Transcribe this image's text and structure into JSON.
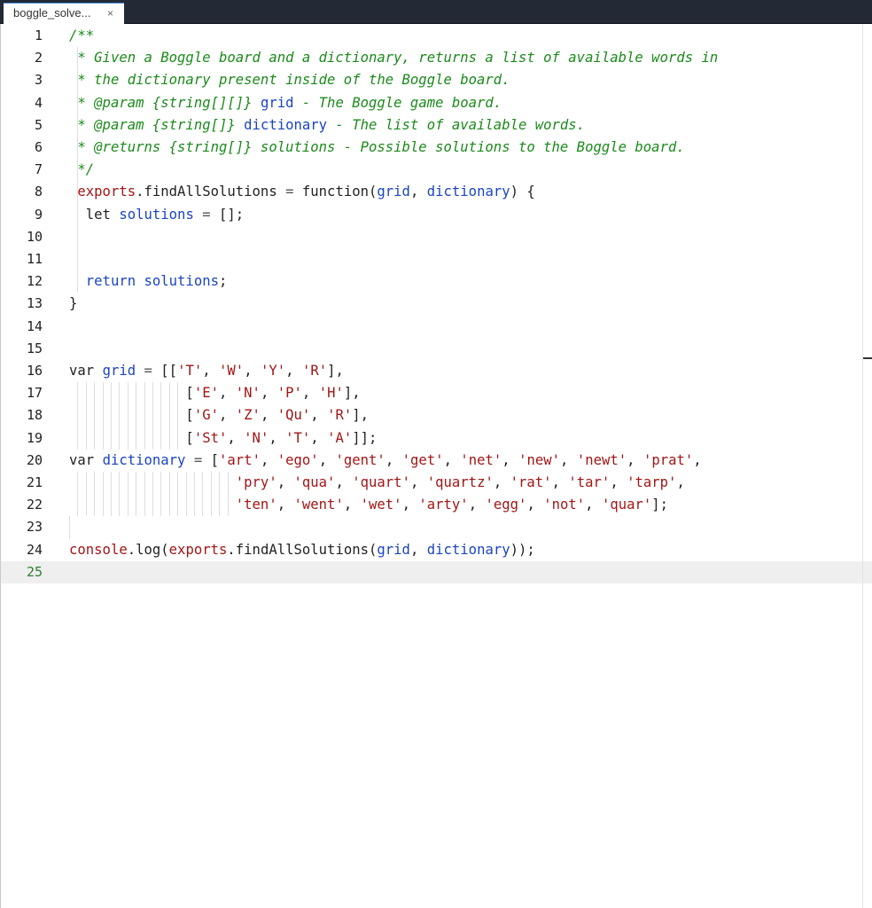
{
  "tab": {
    "title": "boggle_solve...",
    "close_glyph": "×"
  },
  "gutter": {
    "current_line": "25"
  },
  "lines": [
    {
      "n": "1",
      "tokens": [
        {
          "c": "cmt",
          "t": "/**"
        }
      ]
    },
    {
      "n": "2",
      "tokens": [
        {
          "c": "cmt",
          "t": " * Given a Boggle board and a dictionary, returns a list of available words in"
        }
      ]
    },
    {
      "n": "3",
      "tokens": [
        {
          "c": "cmt",
          "t": " * the dictionary present inside of the Boggle board."
        }
      ]
    },
    {
      "n": "4",
      "tokens": [
        {
          "c": "cmt",
          "t": " * @param {string[][]} "
        },
        {
          "c": "var",
          "t": "grid"
        },
        {
          "c": "cmt",
          "t": " - The Boggle game board."
        }
      ]
    },
    {
      "n": "5",
      "tokens": [
        {
          "c": "cmt",
          "t": " * @param {string[]} "
        },
        {
          "c": "var",
          "t": "dictionary"
        },
        {
          "c": "cmt",
          "t": " - The list of available words."
        }
      ]
    },
    {
      "n": "6",
      "tokens": [
        {
          "c": "cmt",
          "t": " * @returns {string[]} solutions - Possible solutions to the Boggle board."
        }
      ]
    },
    {
      "n": "7",
      "tokens": [
        {
          "c": "cmt",
          "t": " */"
        }
      ]
    },
    {
      "n": "8",
      "tokens": [
        {
          "c": "prop",
          "t": " exports"
        },
        {
          "c": "kw",
          "t": ".findAllSolutions "
        },
        {
          "c": "op",
          "t": "="
        },
        {
          "c": "kw",
          "t": " function("
        },
        {
          "c": "var",
          "t": "grid"
        },
        {
          "c": "kw",
          "t": ", "
        },
        {
          "c": "var",
          "t": "dictionary"
        },
        {
          "c": "kw",
          "t": ") {"
        }
      ]
    },
    {
      "n": "9",
      "tokens": [
        {
          "c": "kw",
          "t": "  let "
        },
        {
          "c": "var",
          "t": "solutions"
        },
        {
          "c": "op",
          "t": " ="
        },
        {
          "c": "kw",
          "t": " [];"
        }
      ]
    },
    {
      "n": "10",
      "tokens": []
    },
    {
      "n": "11",
      "tokens": []
    },
    {
      "n": "12",
      "tokens": [
        {
          "c": "var",
          "t": "  return solutions"
        },
        {
          "c": "kw",
          "t": ";"
        }
      ]
    },
    {
      "n": "13",
      "tokens": [
        {
          "c": "kw",
          "t": "}"
        }
      ]
    },
    {
      "n": "14",
      "tokens": []
    },
    {
      "n": "15",
      "tokens": []
    },
    {
      "n": "16",
      "tokens": [
        {
          "c": "kw",
          "t": "var "
        },
        {
          "c": "var",
          "t": "grid"
        },
        {
          "c": "op",
          "t": " ="
        },
        {
          "c": "kw",
          "t": " [["
        },
        {
          "c": "str",
          "t": "'T'"
        },
        {
          "c": "kw",
          "t": ", "
        },
        {
          "c": "str",
          "t": "'W'"
        },
        {
          "c": "kw",
          "t": ", "
        },
        {
          "c": "str",
          "t": "'Y'"
        },
        {
          "c": "kw",
          "t": ", "
        },
        {
          "c": "str",
          "t": "'R'"
        },
        {
          "c": "kw",
          "t": "],"
        }
      ]
    },
    {
      "n": "17",
      "tokens": [
        {
          "c": "kw",
          "t": "              ["
        },
        {
          "c": "str",
          "t": "'E'"
        },
        {
          "c": "kw",
          "t": ", "
        },
        {
          "c": "str",
          "t": "'N'"
        },
        {
          "c": "kw",
          "t": ", "
        },
        {
          "c": "str",
          "t": "'P'"
        },
        {
          "c": "kw",
          "t": ", "
        },
        {
          "c": "str",
          "t": "'H'"
        },
        {
          "c": "kw",
          "t": "],"
        }
      ]
    },
    {
      "n": "18",
      "tokens": [
        {
          "c": "kw",
          "t": "              ["
        },
        {
          "c": "str",
          "t": "'G'"
        },
        {
          "c": "kw",
          "t": ", "
        },
        {
          "c": "str",
          "t": "'Z'"
        },
        {
          "c": "kw",
          "t": ", "
        },
        {
          "c": "str",
          "t": "'Qu'"
        },
        {
          "c": "kw",
          "t": ", "
        },
        {
          "c": "str",
          "t": "'R'"
        },
        {
          "c": "kw",
          "t": "],"
        }
      ]
    },
    {
      "n": "19",
      "tokens": [
        {
          "c": "kw",
          "t": "              ["
        },
        {
          "c": "str",
          "t": "'St'"
        },
        {
          "c": "kw",
          "t": ", "
        },
        {
          "c": "str",
          "t": "'N'"
        },
        {
          "c": "kw",
          "t": ", "
        },
        {
          "c": "str",
          "t": "'T'"
        },
        {
          "c": "kw",
          "t": ", "
        },
        {
          "c": "str",
          "t": "'A'"
        },
        {
          "c": "kw",
          "t": "]];"
        }
      ]
    },
    {
      "n": "20",
      "tokens": [
        {
          "c": "kw",
          "t": "var "
        },
        {
          "c": "var",
          "t": "dictionary"
        },
        {
          "c": "op",
          "t": " ="
        },
        {
          "c": "kw",
          "t": " ["
        },
        {
          "c": "str",
          "t": "'art'"
        },
        {
          "c": "kw",
          "t": ", "
        },
        {
          "c": "str",
          "t": "'ego'"
        },
        {
          "c": "kw",
          "t": ", "
        },
        {
          "c": "str",
          "t": "'gent'"
        },
        {
          "c": "kw",
          "t": ", "
        },
        {
          "c": "str",
          "t": "'get'"
        },
        {
          "c": "kw",
          "t": ", "
        },
        {
          "c": "str",
          "t": "'net'"
        },
        {
          "c": "kw",
          "t": ", "
        },
        {
          "c": "str",
          "t": "'new'"
        },
        {
          "c": "kw",
          "t": ", "
        },
        {
          "c": "str",
          "t": "'newt'"
        },
        {
          "c": "kw",
          "t": ", "
        },
        {
          "c": "str",
          "t": "'prat'"
        },
        {
          "c": "kw",
          "t": ","
        }
      ]
    },
    {
      "n": "21",
      "tokens": [
        {
          "c": "kw",
          "t": "                    "
        },
        {
          "c": "str",
          "t": "'pry'"
        },
        {
          "c": "kw",
          "t": ", "
        },
        {
          "c": "str",
          "t": "'qua'"
        },
        {
          "c": "kw",
          "t": ", "
        },
        {
          "c": "str",
          "t": "'quart'"
        },
        {
          "c": "kw",
          "t": ", "
        },
        {
          "c": "str",
          "t": "'quartz'"
        },
        {
          "c": "kw",
          "t": ", "
        },
        {
          "c": "str",
          "t": "'rat'"
        },
        {
          "c": "kw",
          "t": ", "
        },
        {
          "c": "str",
          "t": "'tar'"
        },
        {
          "c": "kw",
          "t": ", "
        },
        {
          "c": "str",
          "t": "'tarp'"
        },
        {
          "c": "kw",
          "t": ","
        }
      ]
    },
    {
      "n": "22",
      "tokens": [
        {
          "c": "kw",
          "t": "                    "
        },
        {
          "c": "str",
          "t": "'ten'"
        },
        {
          "c": "kw",
          "t": ", "
        },
        {
          "c": "str",
          "t": "'went'"
        },
        {
          "c": "kw",
          "t": ", "
        },
        {
          "c": "str",
          "t": "'wet'"
        },
        {
          "c": "kw",
          "t": ", "
        },
        {
          "c": "str",
          "t": "'arty'"
        },
        {
          "c": "kw",
          "t": ", "
        },
        {
          "c": "str",
          "t": "'egg'"
        },
        {
          "c": "kw",
          "t": ", "
        },
        {
          "c": "str",
          "t": "'not'"
        },
        {
          "c": "kw",
          "t": ", "
        },
        {
          "c": "str",
          "t": "'quar'"
        },
        {
          "c": "kw",
          "t": "];"
        }
      ]
    },
    {
      "n": "23",
      "tokens": []
    },
    {
      "n": "24",
      "tokens": [
        {
          "c": "prop",
          "t": "console"
        },
        {
          "c": "kw",
          "t": ".log("
        },
        {
          "c": "prop",
          "t": "exports"
        },
        {
          "c": "kw",
          "t": ".findAllSolutions("
        },
        {
          "c": "var",
          "t": "grid"
        },
        {
          "c": "kw",
          "t": ", "
        },
        {
          "c": "var",
          "t": "dictionary"
        },
        {
          "c": "kw",
          "t": "));"
        }
      ]
    },
    {
      "n": "25",
      "tokens": []
    }
  ]
}
